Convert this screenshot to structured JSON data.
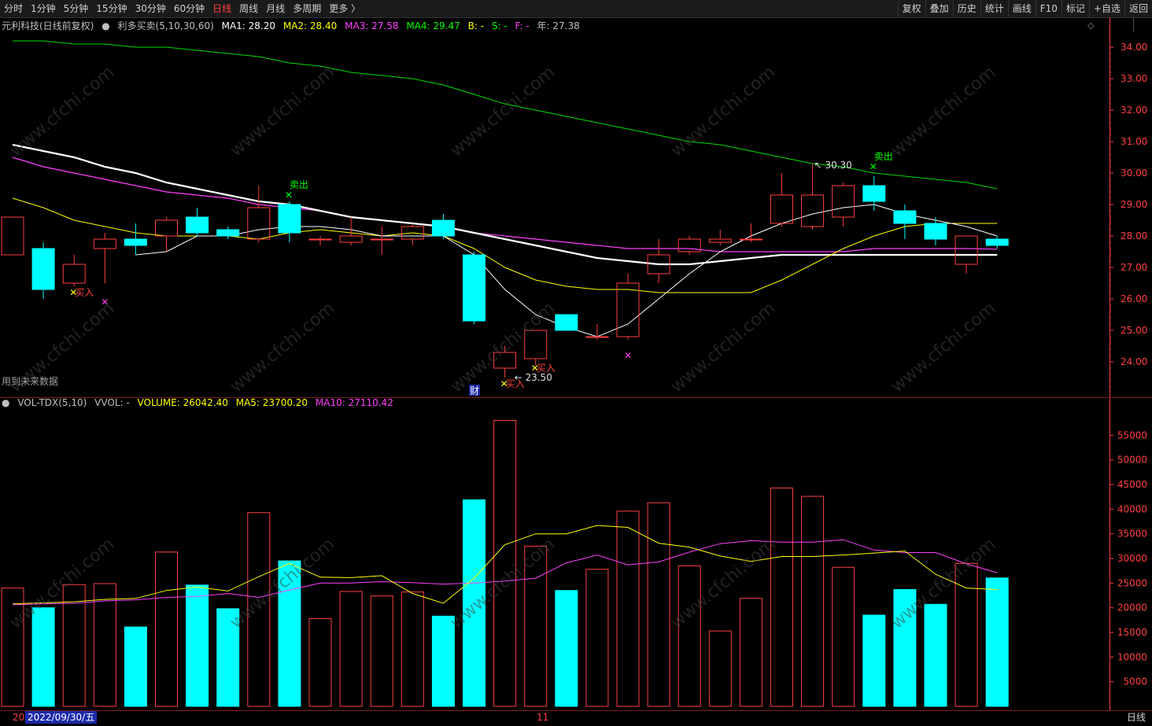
{
  "toolbar": {
    "periods": [
      "分时",
      "1分钟",
      "5分钟",
      "15分钟",
      "30分钟",
      "60分钟",
      "日线",
      "周线",
      "月线",
      "多周期",
      "更多 〉"
    ],
    "active": "日线",
    "right": [
      "复权",
      "叠加",
      "历史",
      "统计",
      "画线",
      "F10",
      "标记",
      "+自选",
      "返回"
    ]
  },
  "price_panel": {
    "stock_label": "元利科技(日线前复权)",
    "indicator": "利多买卖(5,10,30,60)",
    "ma1": "MA1: 28.20",
    "ma2": "MA2: 28.40",
    "ma3": "MA3: 27.58",
    "ma4": "MA4: 29.47",
    "b": "B: -",
    "s": "S: -",
    "f": "F: -",
    "year": "年: 27.38",
    "future_note": "用到未来数据",
    "finance_mark": "财",
    "high_label": "30.30",
    "low_label": "23.50",
    "buy_label": "买入",
    "sell_label": "卖出"
  },
  "volume_panel": {
    "indicator": "VOL-TDX(5,10)",
    "vvol": "VVOL: -",
    "volume": "VOLUME: 26042.40",
    "ma5": "MA5: 23700.20",
    "ma10": "MA10: 27110.42"
  },
  "bottom": {
    "year_prefix": "20",
    "date": "2022/09/30/五",
    "month_mark": "11",
    "period": "日线"
  },
  "colors": {
    "up": "#ff4040",
    "down": "#00ffff",
    "ma1": "#ffffff",
    "ma2": "#ffff00",
    "ma3": "#ff40ff",
    "ma4": "#00dd00",
    "axis": "#ff4040",
    "grid": "#7a1d1d"
  },
  "chart_data": [
    {
      "type": "candlestick",
      "title": "元利科技(日线前复权)",
      "ylim": [
        23.0,
        34.5
      ],
      "yticks": [
        24,
        25,
        26,
        27,
        28,
        29,
        30,
        31,
        32,
        33,
        34
      ],
      "candles": [
        {
          "o": 27.4,
          "h": 28.6,
          "l": 27.4,
          "c": 28.6
        },
        {
          "o": 27.6,
          "h": 27.8,
          "l": 26.0,
          "c": 26.3
        },
        {
          "o": 26.5,
          "h": 27.4,
          "l": 26.4,
          "c": 27.1
        },
        {
          "o": 27.6,
          "h": 28.1,
          "l": 26.5,
          "c": 27.9
        },
        {
          "o": 27.9,
          "h": 28.4,
          "l": 27.4,
          "c": 27.7
        },
        {
          "o": 28.0,
          "h": 28.6,
          "l": 27.5,
          "c": 28.5
        },
        {
          "o": 28.6,
          "h": 28.9,
          "l": 28.0,
          "c": 28.1
        },
        {
          "o": 28.2,
          "h": 28.3,
          "l": 27.9,
          "c": 28.0
        },
        {
          "o": 27.9,
          "h": 29.6,
          "l": 27.8,
          "c": 28.9
        },
        {
          "o": 29.0,
          "h": 29.1,
          "l": 27.8,
          "c": 28.1
        },
        {
          "o": 27.9,
          "h": 28.0,
          "l": 27.7,
          "c": 27.9
        },
        {
          "o": 27.8,
          "h": 28.6,
          "l": 27.7,
          "c": 28.0
        },
        {
          "o": 27.9,
          "h": 28.3,
          "l": 27.4,
          "c": 27.9
        },
        {
          "o": 27.9,
          "h": 28.4,
          "l": 27.7,
          "c": 28.3
        },
        {
          "o": 28.5,
          "h": 28.7,
          "l": 27.9,
          "c": 28.0
        },
        {
          "o": 27.4,
          "h": 27.5,
          "l": 25.2,
          "c": 25.3
        },
        {
          "o": 23.8,
          "h": 24.5,
          "l": 23.5,
          "c": 24.3
        },
        {
          "o": 24.1,
          "h": 25.0,
          "l": 23.9,
          "c": 25.0
        },
        {
          "o": 25.5,
          "h": 25.5,
          "l": 25.0,
          "c": 25.0
        },
        {
          "o": 24.8,
          "h": 25.2,
          "l": 24.7,
          "c": 24.8
        },
        {
          "o": 24.8,
          "h": 26.8,
          "l": 24.7,
          "c": 26.5
        },
        {
          "o": 26.8,
          "h": 27.9,
          "l": 26.5,
          "c": 27.4
        },
        {
          "o": 27.5,
          "h": 28.0,
          "l": 27.4,
          "c": 27.9
        },
        {
          "o": 27.8,
          "h": 28.2,
          "l": 27.7,
          "c": 27.9
        },
        {
          "o": 27.9,
          "h": 28.4,
          "l": 27.8,
          "c": 27.9
        },
        {
          "o": 28.4,
          "h": 30.0,
          "l": 28.3,
          "c": 29.3
        },
        {
          "o": 28.3,
          "h": 30.3,
          "l": 28.2,
          "c": 29.3
        },
        {
          "o": 28.6,
          "h": 29.7,
          "l": 28.3,
          "c": 29.6
        },
        {
          "o": 29.6,
          "h": 29.9,
          "l": 28.8,
          "c": 29.1
        },
        {
          "o": 28.8,
          "h": 29.0,
          "l": 27.9,
          "c": 28.4
        },
        {
          "o": 28.4,
          "h": 28.6,
          "l": 27.7,
          "c": 27.9
        },
        {
          "o": 27.1,
          "h": 28.0,
          "l": 26.8,
          "c": 28.0
        },
        {
          "o": 27.9,
          "h": 28.0,
          "l": 27.6,
          "c": 27.7
        }
      ],
      "ma1": [
        null,
        null,
        null,
        null,
        27.4,
        27.5,
        28.0,
        28.0,
        28.2,
        28.3,
        28.3,
        28.2,
        28.0,
        28.0,
        28.0,
        27.4,
        26.3,
        25.5,
        25.1,
        24.8,
        25.2,
        26.0,
        26.8,
        27.5,
        28.0,
        28.4,
        28.7,
        28.9,
        29.0,
        28.7,
        28.5,
        28.3,
        28.0
      ],
      "ma2": [
        29.2,
        28.9,
        28.5,
        28.3,
        28.1,
        28.0,
        28.0,
        28.0,
        27.9,
        28.1,
        28.2,
        28.1,
        28.0,
        28.1,
        28.0,
        27.6,
        27.0,
        26.6,
        26.4,
        26.3,
        26.3,
        26.2,
        26.2,
        26.2,
        26.2,
        26.6,
        27.1,
        27.6,
        28.0,
        28.3,
        28.4,
        28.4,
        28.4
      ],
      "ma3": [
        30.5,
        30.2,
        30.0,
        29.8,
        29.6,
        29.4,
        29.3,
        29.2,
        29.0,
        28.9,
        28.8,
        28.6,
        28.5,
        28.4,
        28.3,
        28.1,
        28.0,
        27.9,
        27.8,
        27.7,
        27.6,
        27.6,
        27.6,
        27.5,
        27.5,
        27.5,
        27.5,
        27.5,
        27.6,
        27.6,
        27.6,
        27.6,
        27.58
      ],
      "ma_white": [
        30.9,
        30.7,
        30.5,
        30.2,
        30.0,
        29.7,
        29.5,
        29.3,
        29.1,
        29.0,
        28.8,
        28.6,
        28.5,
        28.4,
        28.3,
        28.1,
        27.9,
        27.7,
        27.5,
        27.3,
        27.2,
        27.1,
        27.1,
        27.2,
        27.3,
        27.4,
        27.4,
        27.4,
        27.4,
        27.4,
        27.4,
        27.4,
        27.4
      ],
      "ma4": [
        34.2,
        34.2,
        34.1,
        34.1,
        34.0,
        34.0,
        33.9,
        33.8,
        33.7,
        33.5,
        33.4,
        33.2,
        33.1,
        33.0,
        32.8,
        32.5,
        32.2,
        32.0,
        31.8,
        31.6,
        31.4,
        31.2,
        31.0,
        30.9,
        30.7,
        30.5,
        30.3,
        30.2,
        30.0,
        29.9,
        29.8,
        29.7,
        29.5
      ],
      "signals": [
        {
          "type": "buy",
          "index": 2,
          "price": 26.2
        },
        {
          "type": "cross",
          "index": 3,
          "price": 25.9
        },
        {
          "type": "sell",
          "index": 9,
          "price": 29.3
        },
        {
          "type": "buy",
          "index": 16,
          "price": 23.3
        },
        {
          "type": "buy",
          "index": 17,
          "price": 23.8
        },
        {
          "type": "cross",
          "index": 20,
          "price": 24.2
        },
        {
          "type": "sell",
          "index": 28,
          "price": 30.2
        }
      ]
    },
    {
      "type": "bar",
      "title": "VOL-TDX(5,10)",
      "ylim": [
        0,
        60000
      ],
      "yticks": [
        5000,
        10000,
        15000,
        20000,
        25000,
        30000,
        35000,
        40000,
        45000,
        50000,
        55000
      ],
      "values": [
        24000,
        20000,
        24700,
        24900,
        16100,
        31300,
        24600,
        19800,
        39300,
        29500,
        17800,
        23300,
        22400,
        23200,
        18300,
        41900,
        58000,
        32500,
        23500,
        27800,
        39600,
        41300,
        28500,
        15300,
        21900,
        44300,
        42600,
        28200,
        18500,
        23700,
        20700,
        29000,
        26042
      ],
      "ma5": [
        20800,
        21000,
        21200,
        21700,
        21900,
        23500,
        24200,
        23400,
        26300,
        29000,
        26200,
        26100,
        26500,
        22900,
        20900,
        26000,
        32800,
        35000,
        35000,
        36700,
        36300,
        33100,
        32300,
        30500,
        29400,
        30400,
        30400,
        30700,
        31100,
        31500,
        26800,
        24000,
        23700
      ],
      "ma10": [
        20600,
        20800,
        20900,
        21400,
        21600,
        22100,
        22300,
        22900,
        22100,
        23600,
        25000,
        25000,
        25300,
        25100,
        24800,
        25000,
        25400,
        26000,
        29100,
        30700,
        28700,
        29300,
        31300,
        33000,
        33600,
        33300,
        33300,
        33800,
        31700,
        31200,
        31200,
        28900,
        27110
      ]
    }
  ]
}
